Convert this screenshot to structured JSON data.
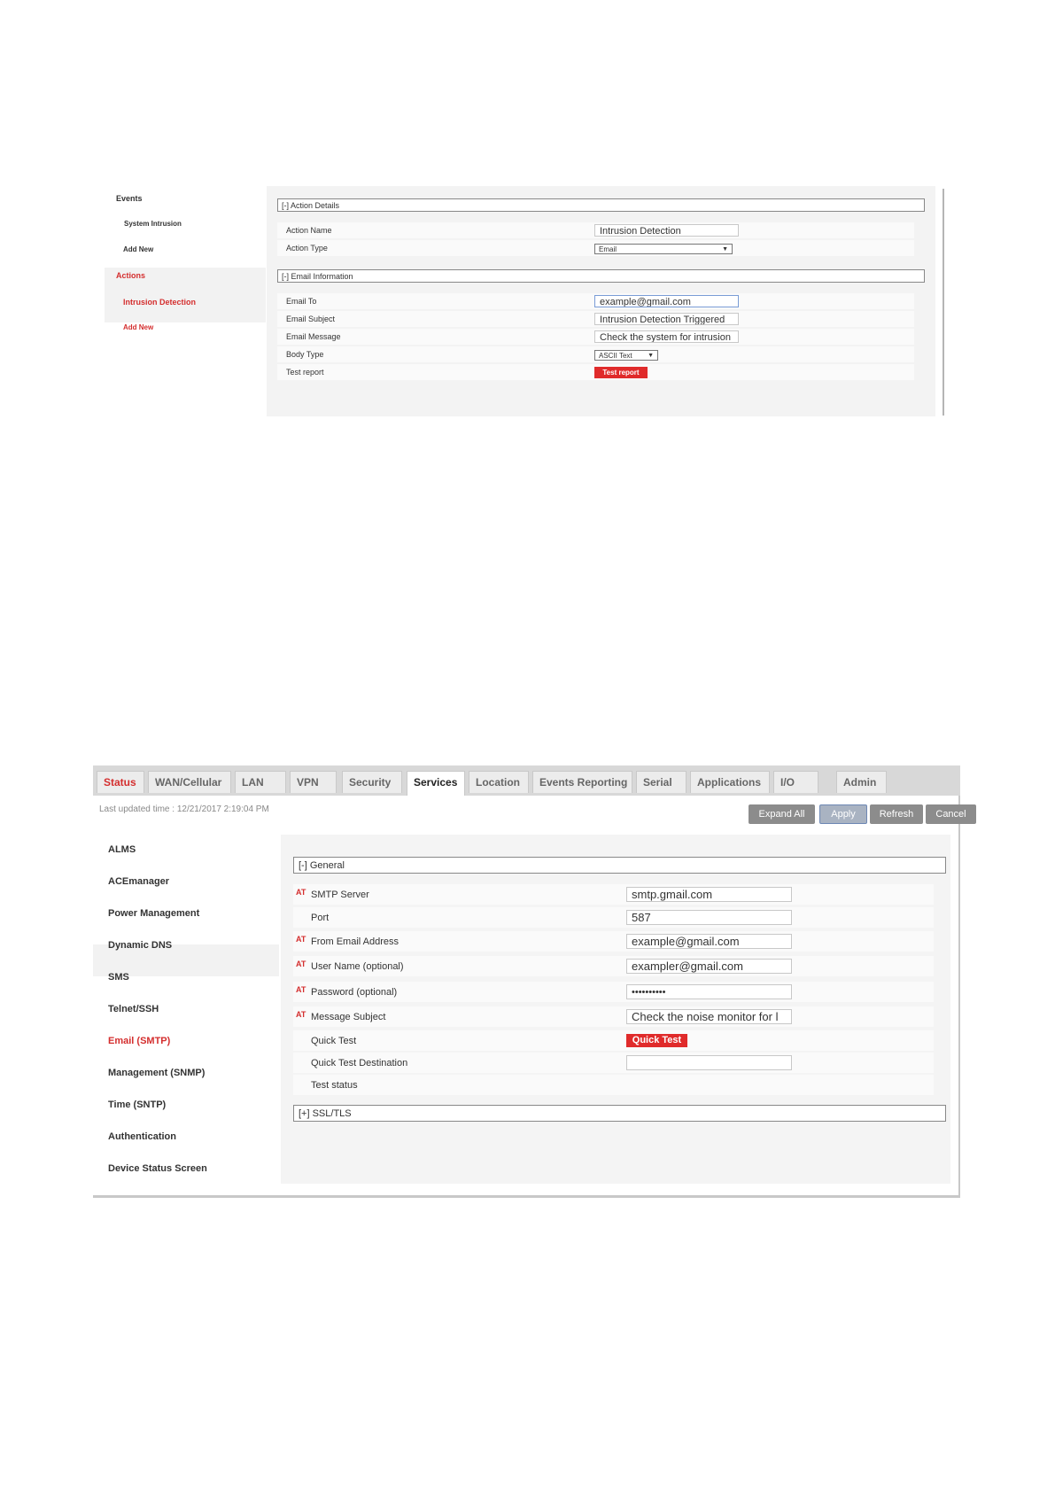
{
  "screen1": {
    "sidebar": {
      "events_heading": "Events",
      "system_intrusion": "System Intrusion",
      "add_new_event": "Add New",
      "actions_heading": "Actions",
      "intrusion_detection": "Intrusion Detection",
      "add_new_action": "Add New"
    },
    "action_details": {
      "header": "[-] Action Details",
      "action_name_label": "Action Name",
      "action_name_value": "Intrusion Detection",
      "action_type_label": "Action Type",
      "action_type_value": "Email"
    },
    "email_information": {
      "header": "[-] Email Information",
      "email_to_label": "Email To",
      "email_to_value": "example@gmail.com",
      "email_subject_label": "Email Subject",
      "email_subject_value": "Intrusion Detection Triggered",
      "email_message_label": "Email Message",
      "email_message_value": "Check the system for intrusion",
      "body_type_label": "Body Type",
      "body_type_value": "ASCII Text",
      "test_report_label": "Test report",
      "test_report_button": "Test report"
    }
  },
  "screen2": {
    "tabs": [
      {
        "label": "Status"
      },
      {
        "label": "WAN/Cellular"
      },
      {
        "label": "LAN"
      },
      {
        "label": "VPN"
      },
      {
        "label": "Security"
      },
      {
        "label": "Services"
      },
      {
        "label": "Location"
      },
      {
        "label": "Events Reporting"
      },
      {
        "label": "Serial"
      },
      {
        "label": "Applications"
      },
      {
        "label": "I/O"
      },
      {
        "label": "Admin"
      }
    ],
    "last_updated": "Last updated time : 12/21/2017 2:19:04 PM",
    "toolbar": {
      "expand_all": "Expand All",
      "apply": "Apply",
      "refresh": "Refresh",
      "cancel": "Cancel"
    },
    "sidebar": [
      {
        "label": "ALMS"
      },
      {
        "label": "ACEmanager"
      },
      {
        "label": "Power Management"
      },
      {
        "label": "Dynamic DNS"
      },
      {
        "label": "SMS"
      },
      {
        "label": "Telnet/SSH"
      },
      {
        "label": "Email (SMTP)"
      },
      {
        "label": "Management (SNMP)"
      },
      {
        "label": "Time (SNTP)"
      },
      {
        "label": "Authentication"
      },
      {
        "label": "Device Status Screen"
      }
    ],
    "general": {
      "header": "[-] General",
      "at_marker": "AT",
      "smtp_server_label": "SMTP Server",
      "smtp_server_value": "smtp.gmail.com",
      "port_label": "Port",
      "port_value": "587",
      "from_email_label": "From Email Address",
      "from_email_value": "example@gmail.com",
      "user_name_label": "User Name (optional)",
      "user_name_value": "exampler@gmail.com",
      "password_label": "Password (optional)",
      "password_value": "••••••••••",
      "message_subject_label": "Message Subject",
      "message_subject_value": "Check the noise monitor for l",
      "quick_test_label": "Quick Test",
      "quick_test_button": "Quick Test",
      "quick_test_destination_label": "Quick Test Destination",
      "quick_test_destination_value": "",
      "test_status_label": "Test status"
    },
    "ssl_tls_header": "[+] SSL/TLS",
    "colors": {
      "accent_red": "#d42e2e",
      "button_red": "#e02b2b",
      "button_gray": "#8c8c8c"
    }
  }
}
